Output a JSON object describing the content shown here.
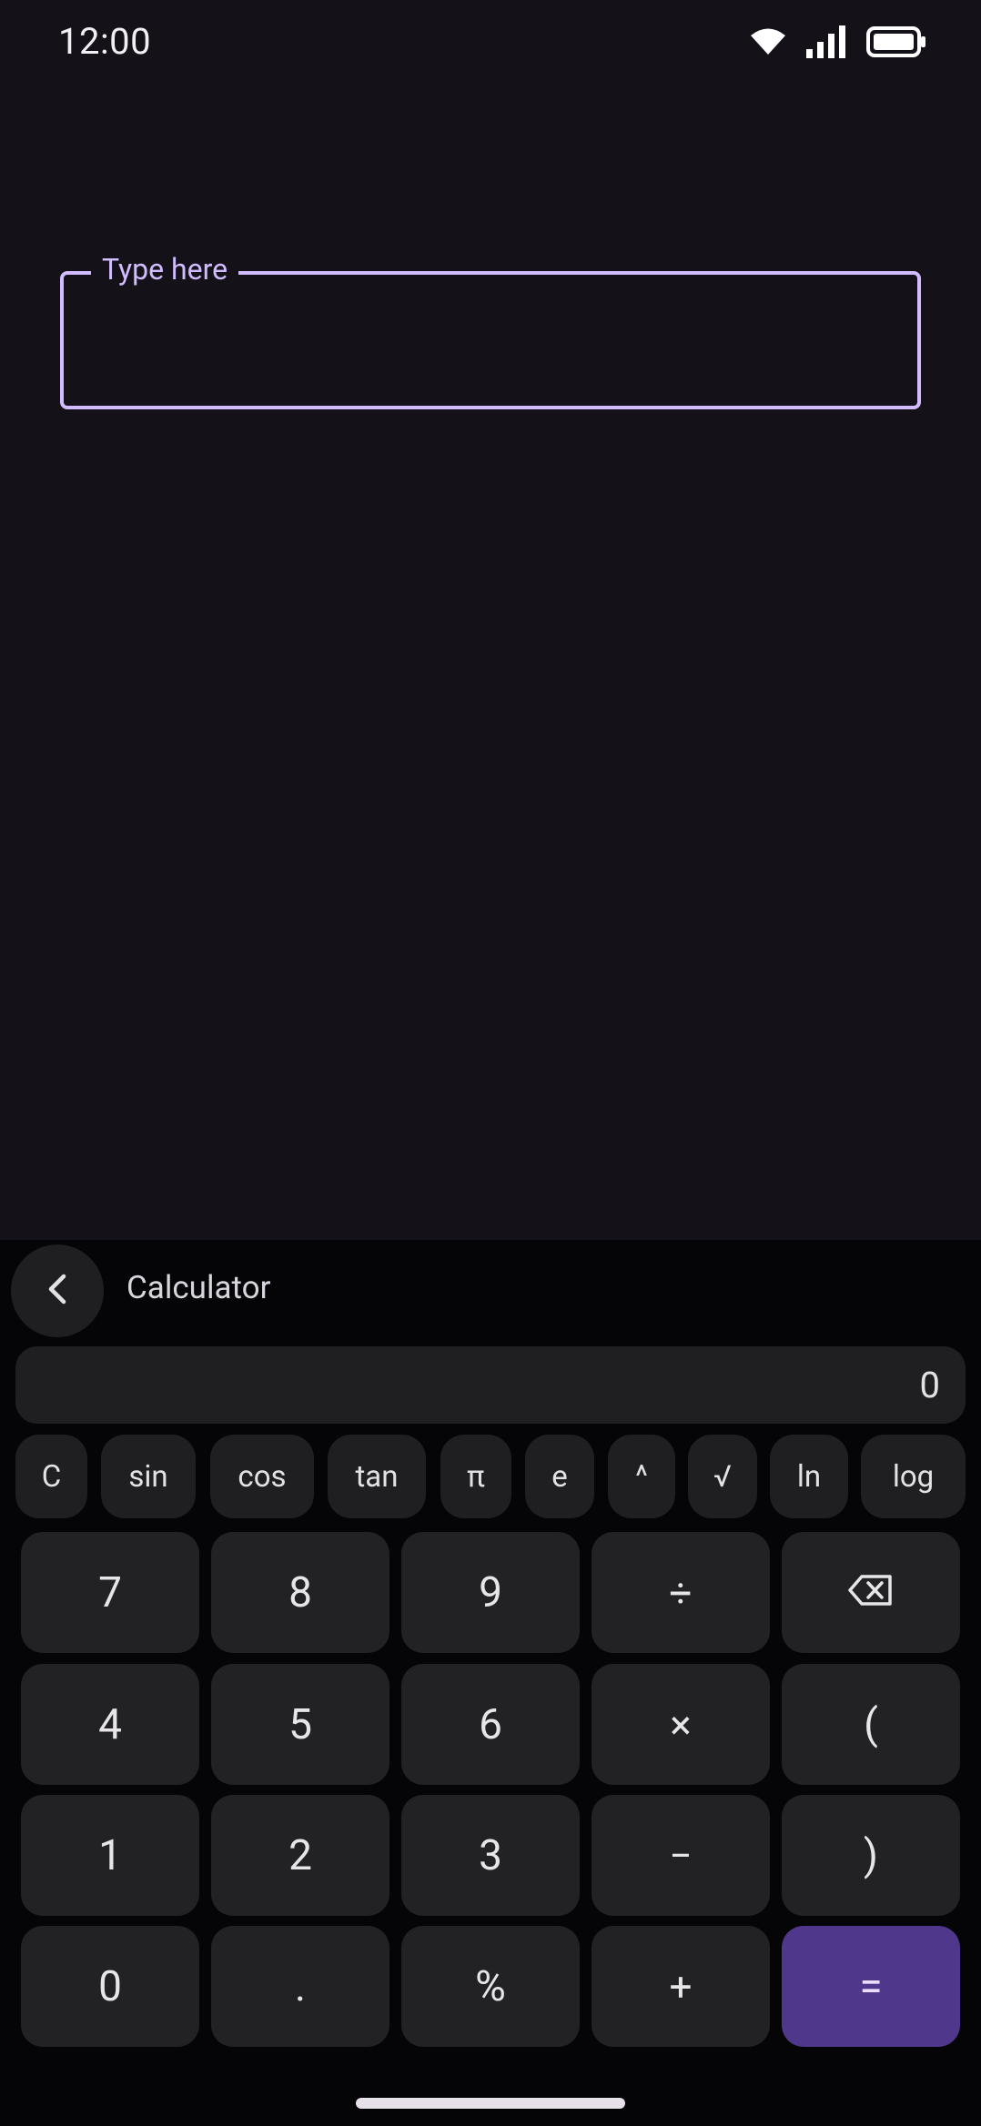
{
  "status_bar": {
    "time": "12:00",
    "icons": [
      "wifi-icon",
      "signal-icon",
      "battery-icon"
    ]
  },
  "text_field": {
    "label": "Type here",
    "value": "",
    "accent_color": "#d0bcff"
  },
  "keyboard": {
    "title": "Calculator",
    "back_icon": "chevron-left-icon",
    "display_value": "0",
    "function_keys": [
      "C",
      "sin",
      "cos",
      "tan",
      "π",
      "e",
      "^",
      "√",
      "ln",
      "log"
    ],
    "keys": {
      "k7": "7",
      "k8": "8",
      "k9": "9",
      "divide": "÷",
      "backspace_icon": "backspace-icon",
      "k4": "4",
      "k5": "5",
      "k6": "6",
      "multiply": "×",
      "lparen": "(",
      "k1": "1",
      "k2": "2",
      "k3": "3",
      "minus": "−",
      "rparen": ")",
      "k0": "0",
      "dot": ".",
      "percent": "%",
      "plus": "+",
      "equals": "="
    },
    "equals_color": "#4f378b"
  }
}
